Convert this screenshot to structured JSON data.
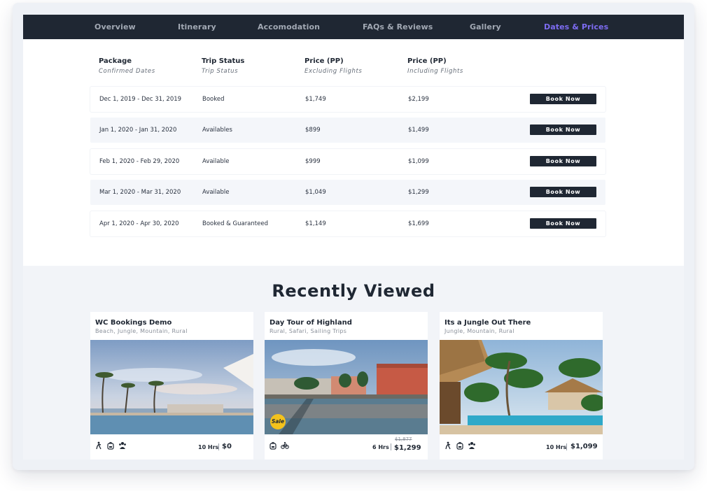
{
  "tabs": [
    {
      "label": "Overview"
    },
    {
      "label": "Itinerary"
    },
    {
      "label": "Accomodation"
    },
    {
      "label": "FAQs & Reviews"
    },
    {
      "label": "Gallery"
    },
    {
      "label": "Dates & Prices",
      "active": true
    }
  ],
  "table": {
    "headers": [
      {
        "title": "Package",
        "sub": "Confirmed Dates"
      },
      {
        "title": "Trip Status",
        "sub": "Trip Status"
      },
      {
        "title": "Price (PP)",
        "sub": "Excluding Flights"
      },
      {
        "title": "Price (PP)",
        "sub": "Including Flights"
      }
    ],
    "rows": [
      {
        "dates": "Dec 1, 2019 - Dec 31, 2019",
        "status": "Booked",
        "excl": "$1,749",
        "incl": "$2,199",
        "button": "Book Now"
      },
      {
        "dates": "Jan 1, 2020 - Jan 31, 2020",
        "status": "Availables",
        "excl": "$899",
        "incl": "$1,499",
        "button": "Book Now"
      },
      {
        "dates": "Feb 1, 2020 - Feb 29, 2020",
        "status": "Available",
        "excl": "$999",
        "incl": "$1,099",
        "button": "Book Now"
      },
      {
        "dates": "Mar 1, 2020 - Mar 31, 2020",
        "status": "Available",
        "excl": "$1,049",
        "incl": "$1,299",
        "button": "Book Now"
      },
      {
        "dates": "Apr 1, 2020 - Apr 30, 2020",
        "status": "Booked & Guaranteed",
        "excl": "$1,149",
        "incl": "$1,699",
        "button": "Book Now"
      }
    ]
  },
  "recent": {
    "title": "Recently Viewed",
    "cards": [
      {
        "title": "WC Bookings Demo",
        "tags": "Beach,  Jungle,  Mountain,  Rural",
        "duration": "10 Hrs",
        "price": "$0",
        "icons": [
          "hiking-icon",
          "backpack-icon",
          "group-icon"
        ]
      },
      {
        "title": "Day Tour of Highland",
        "tags": "Rural,  Safari,  Sailing Trips",
        "duration": "6 Hrs",
        "old_price": "$1,877",
        "price": "$1,299",
        "badge": "Sale",
        "icons": [
          "backpack-icon",
          "bicycle-icon"
        ]
      },
      {
        "title": "Its a Jungle Out There",
        "tags": "Jungle,  Mountain,  Rural",
        "duration": "10 Hrs",
        "price": "$1,099",
        "icons": [
          "hiking-icon",
          "backpack-icon",
          "group-icon"
        ]
      }
    ]
  },
  "colors": {
    "nav_bg": "#1f2733",
    "nav_text": "#a2a9b4",
    "nav_active": "#7d6cf2",
    "button_bg": "#1f2733",
    "sale_badge": "#f4c21c",
    "section_bg": "#f2f4f8"
  }
}
